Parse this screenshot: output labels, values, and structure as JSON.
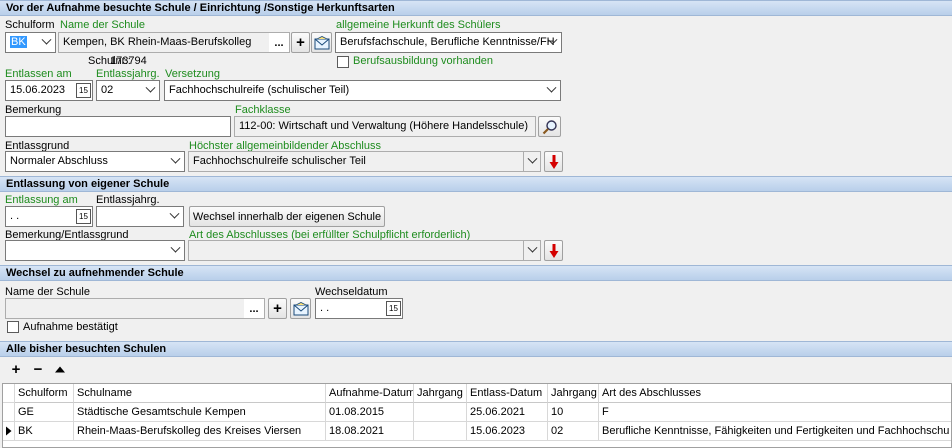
{
  "sec1": {
    "header": "Vor der Aufnahme besuchte Schule / Einrichtung /Sonstige Herkunftsarten",
    "schulform_label": "Schulform",
    "schulform_value": "BK",
    "schule_label": "Name der Schule",
    "schule_value": "Kempen, BK Rhein-Maas-Berufskolleg",
    "schulnr_label": "Schulnr.:",
    "schulnr_value": "173794",
    "herkunft_label": "allgemeine Herkunft des Schülers",
    "herkunft_value": "Berufsfachschule, Berufliche Kenntnisse/FH",
    "berufsausbildung_label": "Berufsausbildung vorhanden",
    "entlassen_label": "Entlassen am",
    "entlassen_value": "15.06.2023",
    "entlassjahrg_label": "Entlassjahrg.",
    "entlassjahrg_value": "02",
    "versetzung_label": "Versetzung",
    "versetzung_value": "Fachhochschulreife (schulischer Teil)",
    "bemerkung_label": "Bemerkung",
    "bemerkung_value": "",
    "fachklasse_label": "Fachklasse",
    "fachklasse_value": "112-00: Wirtschaft und Verwaltung (Höhere Handelsschule)",
    "entlassgrund_label": "Entlassgrund",
    "entlassgrund_value": "Normaler Abschluss",
    "abschluss_label": "Höchster allgemeinbildender Abschluss",
    "abschluss_value": "Fachhochschulreife schulischer Teil"
  },
  "sec2": {
    "header": "Entlassung von eigener Schule",
    "entlassung_label": "Entlassung am",
    "entlassung_value": " .  .",
    "entlassjahrg_label": "Entlassjahrg.",
    "entlassjahrg_value": "",
    "wechsel_button": "Wechsel innerhalb der eigenen Schule",
    "bemerkung_label": "Bemerkung/Entlassgrund",
    "bemerkung_value": "",
    "art_label": "Art des Abschlusses (bei erfüllter Schulpflicht erforderlich)",
    "art_value": ""
  },
  "sec3": {
    "header": "Wechsel zu aufnehmender Schule",
    "schule_label": "Name der Schule",
    "schule_value": "",
    "wechseldatum_label": "Wechseldatum",
    "wechseldatum_value": " .  .",
    "aufnahme_label": "Aufnahme bestätigt"
  },
  "sec4": {
    "header": "Alle bisher besuchten Schulen",
    "columns": [
      "Schulform",
      "Schulname",
      "Aufnahme-Datum",
      "Jahrgang",
      "Entlass-Datum",
      "Jahrgang",
      "Art des Abschlusses"
    ],
    "rows": [
      [
        "GE",
        "Städtische Gesamtschule Kempen",
        "01.08.2015",
        "",
        "25.06.2021",
        "10",
        "F"
      ],
      [
        "BK",
        "Rhein-Maas-Berufskolleg des Kreises Viersen",
        "18.08.2021",
        "",
        "15.06.2023",
        "02",
        "Berufliche Kenntnisse, Fähigkeiten und Fertigkeiten und Fachhochschu"
      ]
    ]
  },
  "icons": {
    "ellipsis": "...",
    "plus": "+",
    "minus": "−",
    "cal": "15"
  },
  "colors": {
    "green_label": "#1e8c1e",
    "header_bg": "#c8daf0",
    "arrow_red": "#d40000"
  }
}
